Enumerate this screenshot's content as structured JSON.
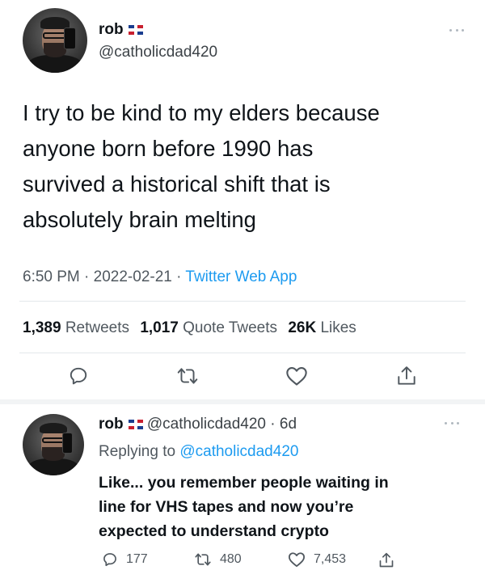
{
  "tweet": {
    "author_name": "rob",
    "author_handle": "@catholicdad420",
    "text": "I try to be kind to my elders because\nanyone born before 1990 has\nsurvived a historical shift that is\nabsolutely brain melting",
    "time": "6:50 PM",
    "date": "2022-02-21",
    "separator": "·",
    "source": "Twitter Web App",
    "retweets_count": "1,389",
    "retweets_label": "Retweets",
    "quotes_count": "1,017",
    "quotes_label": "Quote Tweets",
    "likes_count": "26K",
    "likes_label": "Likes"
  },
  "reply": {
    "author_name": "rob",
    "author_handle": "@catholicdad420",
    "time_ago": "· 6d",
    "replying_prefix": "Replying to",
    "replying_to": "@catholicdad420",
    "text": "Like... you remember people waiting in\nline for VHS tapes and now you’re\nexpected to understand crypto",
    "reply_count": "177",
    "retweet_count": "480",
    "like_count": "7,453"
  },
  "colors": {
    "link": "#1d9bf0",
    "text": "#0f1419",
    "secondary": "#50585f"
  },
  "icons": {
    "reply": "reply-icon",
    "retweet": "retweet-icon",
    "like": "heart-icon",
    "share": "share-icon",
    "more": "more-icon",
    "flag": "dominican-flag-icon"
  }
}
